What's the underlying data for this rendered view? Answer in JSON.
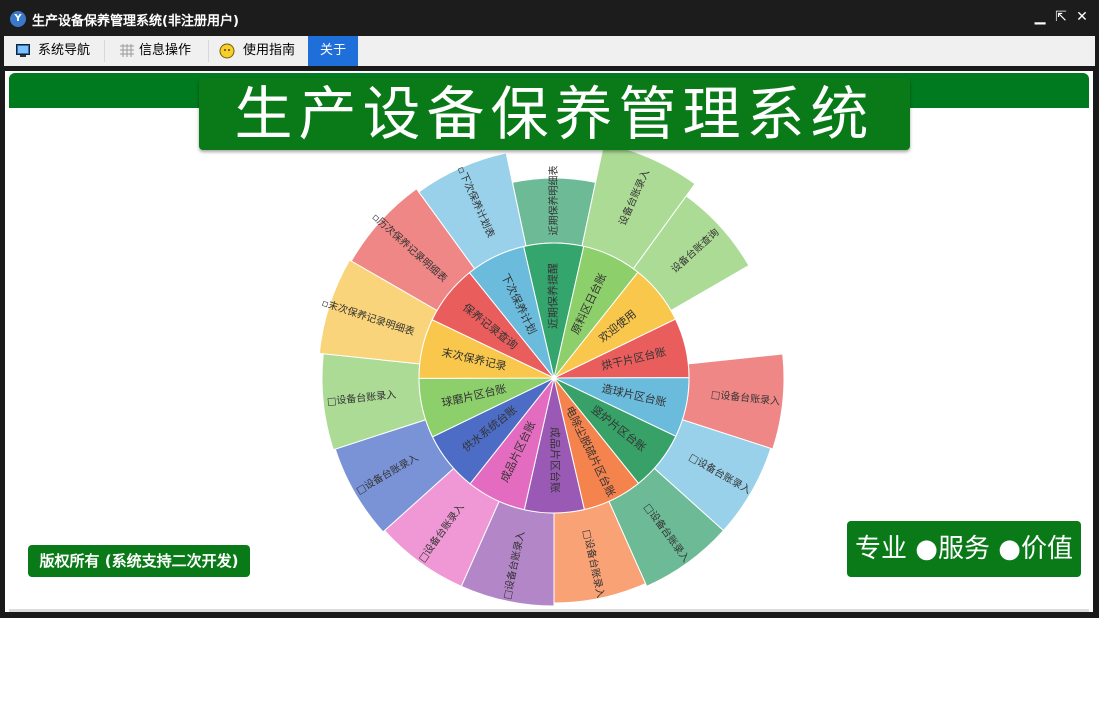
{
  "window": {
    "title": "生产设备保养管理系统(非注册用户)",
    "controls": {
      "minimize": "▁",
      "restore": "⇱",
      "close": "✕"
    }
  },
  "menu": {
    "items": [
      {
        "label": "系统导航",
        "icon": "monitor-icon"
      },
      {
        "label": "信息操作",
        "icon": "grid-icon"
      },
      {
        "label": "使用指南",
        "icon": "smiley-icon"
      },
      {
        "label": "关于",
        "active": true
      }
    ]
  },
  "banner": {
    "title": "生产设备保养管理系统"
  },
  "copyright": "版权所有 (系统支持二次开发)",
  "slogan": "专业 ●服务 ●价值",
  "sunburst": {
    "inner": [
      {
        "label": "近期保养提醒",
        "color": "#35a56e"
      },
      {
        "label": "原料区日台账",
        "color": "#8ccf6b"
      },
      {
        "label": "欢迎使用",
        "color": "#f8c74b"
      },
      {
        "label": "烘干片区台账",
        "color": "#ea5d5d"
      },
      {
        "label": "造球片区台账",
        "color": "#6bbbdd"
      },
      {
        "label": "竖炉片区台账",
        "color": "#37a168"
      },
      {
        "label": "电除尘脱硫片区台账",
        "color": "#f5834e"
      },
      {
        "label": "成品片区台账",
        "color": "#9b59b6"
      },
      {
        "label": "成品片区台账",
        "color": "#e46cc0"
      },
      {
        "label": "供水系统台账",
        "color": "#4c6cc6"
      },
      {
        "label": "球磨片区台账",
        "color": "#8ccf6b"
      },
      {
        "label": "末次保养记录",
        "color": "#f8c74b"
      },
      {
        "label": "保养记录查询",
        "color": "#ea5d5d"
      },
      {
        "label": "下次保养计划",
        "color": "#6bbbdd"
      }
    ],
    "outer": [
      {
        "label": "近期保养明细表",
        "color": "#6dbb96"
      },
      {
        "label": "设备台账录入",
        "color": "#acdb96"
      },
      {
        "label": "设备台账查询",
        "color": "#acdb96"
      },
      {
        "label": "",
        "color": "#ffffff"
      },
      {
        "label": "□设备台账录入",
        "color": "#f08787"
      },
      {
        "label": "□设备台账录入",
        "color": "#99d1ea"
      },
      {
        "label": "□设备台账录入",
        "color": "#6dbb96"
      },
      {
        "label": "□设备台账录入",
        "color": "#f9a276"
      },
      {
        "label": "□设备台账录入",
        "color": "#b386c8"
      },
      {
        "label": "□设备台账录入",
        "color": "#ef98d5"
      },
      {
        "label": "□设备台账录入",
        "color": "#7a93d6"
      },
      {
        "label": "□设备台账录入",
        "color": "#acdb96"
      },
      {
        "label": "▫末次保养记录明细表",
        "color": "#f9d47a"
      },
      {
        "label": "▫历次保养记录明细表",
        "color": "#f08787"
      },
      {
        "label": "▫下次保养计划表",
        "color": "#99d1ea"
      }
    ]
  }
}
